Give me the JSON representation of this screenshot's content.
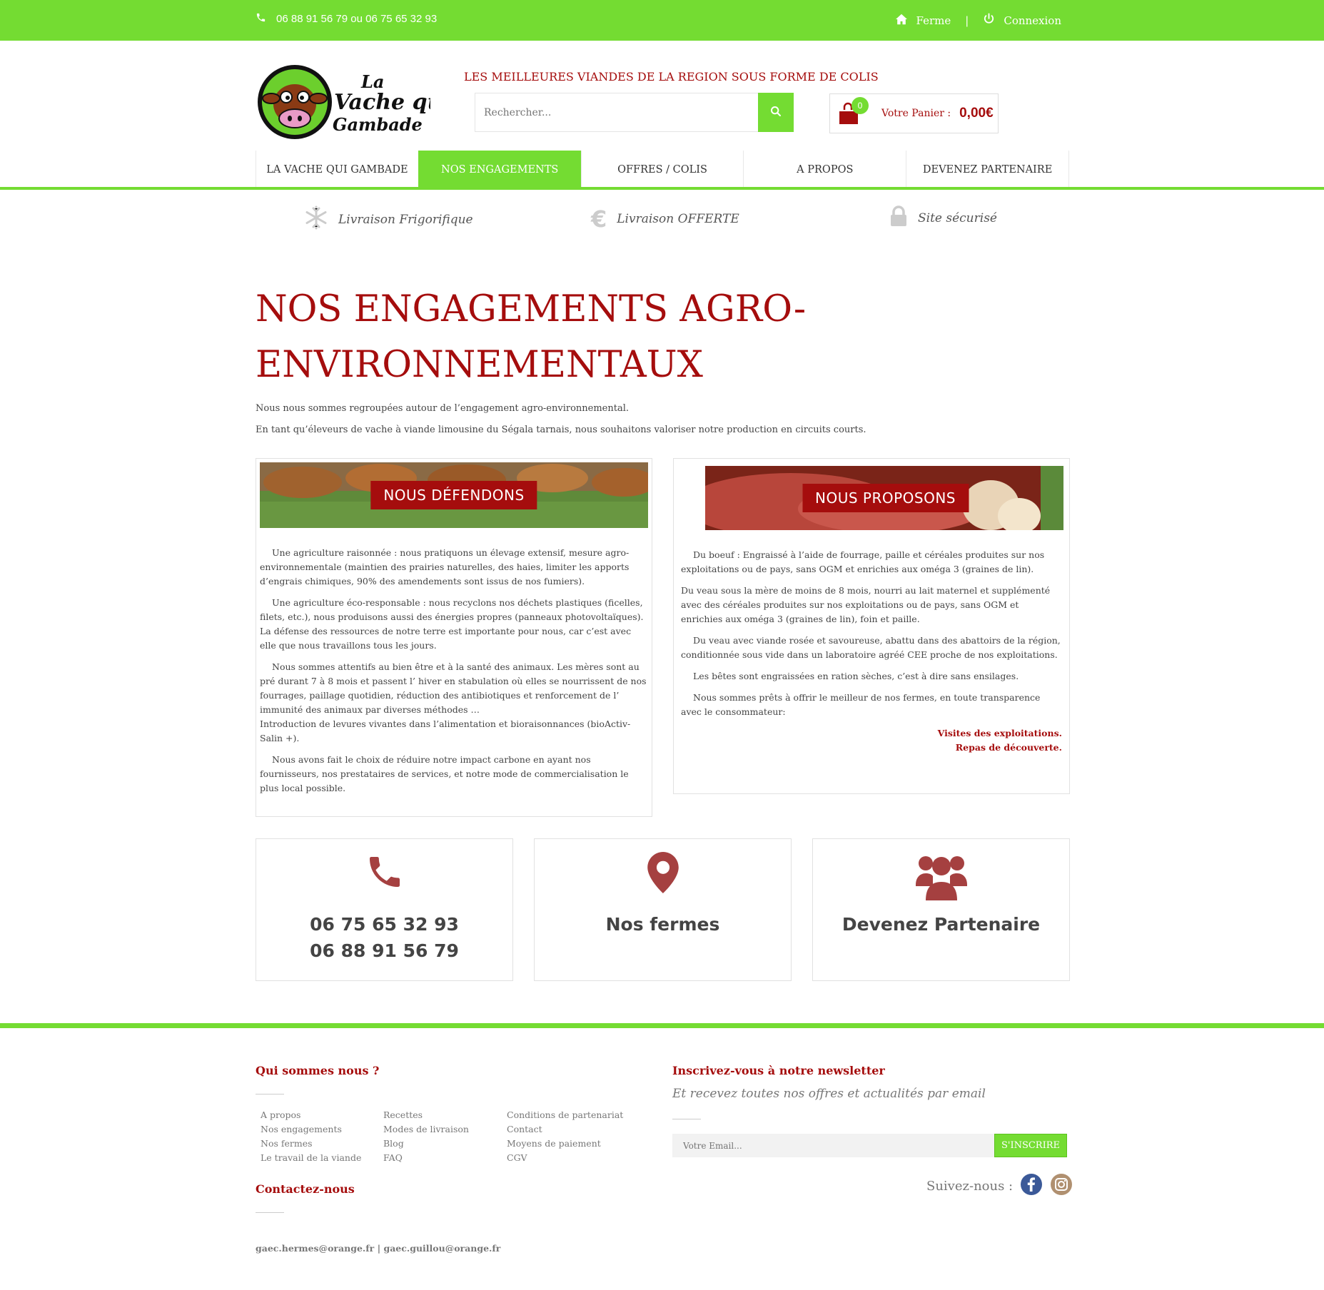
{
  "topbar": {
    "phones": "06 88 91 56 79 ou 06 75 65 32 93",
    "home_label": "Ferme",
    "separator": "|",
    "login_label": "Connexion"
  },
  "header": {
    "logo_text_1": "La",
    "logo_text_2": "Vache qui",
    "logo_text_3": "Gambade",
    "tagline": "LES MEILLEURES VIANDES DE LA REGION SOUS FORME DE COLIS",
    "search_placeholder": "Rechercher...",
    "cart_count": "0",
    "cart_label": "Votre Panier :",
    "cart_total": "0,00€"
  },
  "nav": {
    "items": [
      {
        "label": "LA VACHE QUI GAMBADE"
      },
      {
        "label": "NOS ENGAGEMENTS"
      },
      {
        "label": "OFFRES / COLIS"
      },
      {
        "label": "A PROPOS"
      },
      {
        "label": "DEVENEZ PARTENAIRE"
      }
    ]
  },
  "features": [
    {
      "label": "Livraison Frigorifique",
      "icon": "snowflake-icon"
    },
    {
      "label": "Livraison OFFERTE",
      "icon": "euro-icon"
    },
    {
      "label": "Site sécurisé",
      "icon": "lock-icon"
    }
  ],
  "main": {
    "title": "NOS ENGAGEMENTS AGRO-ENVIRONNEMENTAUX",
    "intro_1": "Nous nous sommes regroupées autour de l’engagement agro-environnemental.",
    "intro_2": "En tant qu’éleveurs de vache à viande limousine du Ségala tarnais, nous souhaitons valoriser notre production en circuits courts."
  },
  "defend": {
    "banner": "NOUS DÉFENDONS",
    "p1": "Une agriculture raisonnée : nous pratiquons un élevage extensif, mesure agro-environnementale (maintien des prairies naturelles, des haies, limiter les apports d’engrais chimiques, 90% des amendements sont issus de nos fumiers).",
    "p2": "Une agriculture éco-responsable : nous recyclons nos déchets plastiques (ficelles, filets, etc.), nous produisons aussi des énergies propres (panneaux photovoltaïques). La défense des ressources de notre terre est importante pour nous, car c’est avec elle que nous travaillons tous les jours.",
    "p3": "Nous sommes attentifs au bien être et à la santé des animaux. Les mères sont au pré durant 7 à 8 mois et passent l’ hiver en stabulation où elles se nourrissent de nos fourrages, paillage quotidien, réduction des antibiotiques et renforcement de l’ immunité des animaux par diverses méthodes …",
    "p3b": "Introduction de levures vivantes dans l’alimentation et bioraisonnances (bioActiv-Salin +).",
    "p4": "Nous avons fait le choix de réduire notre impact carbone en ayant nos fournisseurs, nos prestataires de services, et notre mode de commercialisation le plus local possible."
  },
  "propose": {
    "banner": "NOUS PROPOSONS",
    "p1": "Du boeuf : Engraissé à l’aide de fourrage, paille et céréales produites sur nos exploitations ou de pays, sans OGM et enrichies aux oméga 3 (graines de lin).",
    "p2": "Du veau sous la mère de moins de 8 mois, nourri au lait maternel et supplémenté avec des céréales produites sur nos exploitations ou de pays, sans OGM et enrichies aux oméga 3 (graines de lin), foin et paille.",
    "p3": "Du veau avec viande rosée et savoureuse, abattu dans des abattoirs de la région, conditionnée sous vide dans un laboratoire agréé CEE proche de nos exploitations.",
    "p4": "Les bêtes sont engraissées en ration sèches, c’est à dire sans ensilages.",
    "p5": "Nous sommes prêts à offrir le meilleur de nos fermes, en toute transparence avec le consommateur:",
    "link1": "Visites des exploitations.",
    "link2": "Repas de découverte."
  },
  "cards": {
    "phone1": "06 75 65 32 93",
    "phone2": "06 88 91 56 79",
    "farms": "Nos fermes",
    "partner": "Devenez Partenaire"
  },
  "footer": {
    "about_title": "Qui sommes nous ?",
    "col1": [
      "A propos",
      "Nos engagements",
      "Nos fermes",
      "Le travail de la viande"
    ],
    "col2": [
      "Recettes",
      "Modes de livraison",
      "Blog",
      "FAQ"
    ],
    "col3": [
      "Conditions de partenariat",
      "Contact",
      "Moyens de paiement",
      "CGV"
    ],
    "contact_title": "Contactez-nous",
    "emails": "gaec.hermes@orange.fr | gaec.guillou@orange.fr",
    "newsletter_title": "Inscrivez-vous à notre newsletter",
    "newsletter_sub": "Et recevez toutes nos offres et actualités par email",
    "email_placeholder": "Votre Email...",
    "subscribe": "S'INSCRIRE",
    "follow": "Suivez-nous :"
  },
  "colors": {
    "brand_green": "#74dc32",
    "brand_red": "#a50d0d"
  }
}
